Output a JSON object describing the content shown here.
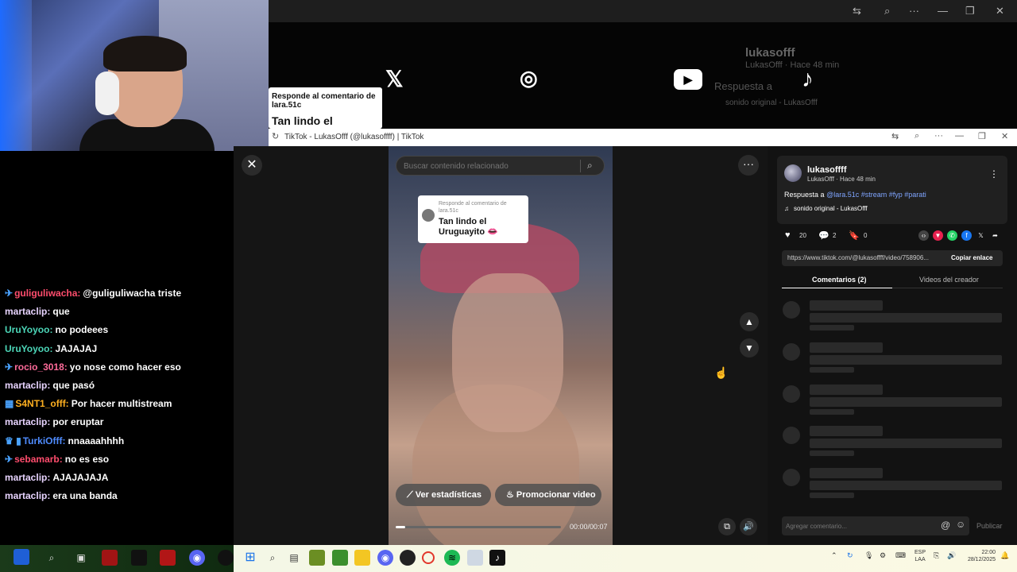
{
  "background_window": {
    "username": "lukasofff",
    "meta": "LukasOfff · Hace 48 min",
    "reply_prefix": "Respuesta a",
    "sound": "sonido original - LukasOfff",
    "reply_card_small": "Responde al comentario de lara.51c",
    "reply_card_large": "Tan lindo el"
  },
  "chat": [
    {
      "badge": "✈",
      "user": "guliguliwacha:",
      "user_color": "#ff4d6d",
      "msg": "@guliguliwacha triste"
    },
    {
      "badge": "",
      "user": "martaclip:",
      "user_color": "#e8d4ff",
      "msg": "que"
    },
    {
      "badge": "",
      "user": "UruYoyoo:",
      "user_color": "#4cd6b8",
      "msg": "no podeees"
    },
    {
      "badge": "",
      "user": "UruYoyoo:",
      "user_color": "#4cd6b8",
      "msg": "JAJAJAJ"
    },
    {
      "badge": "✈",
      "user": "rocio_3018:",
      "user_color": "#ff6b9a",
      "msg": "yo nose como hacer eso"
    },
    {
      "badge": "",
      "user": "martaclip:",
      "user_color": "#e8d4ff",
      "msg": "que pasó"
    },
    {
      "badge": "▦",
      "user": "S4NT1_offf:",
      "user_color": "#ffb020",
      "msg": "Por hacer multistream"
    },
    {
      "badge": "",
      "user": "martaclip:",
      "user_color": "#e8d4ff",
      "msg": "por eruptar"
    },
    {
      "badge": "♛ ▮",
      "user": "TurkiOfff:",
      "user_color": "#4f8cff",
      "msg": "nnaaaahhhh"
    },
    {
      "badge": "✈",
      "user": "sebamarb:",
      "user_color": "#ff4d6d",
      "msg": "no es eso"
    },
    {
      "badge": "",
      "user": "martaclip:",
      "user_color": "#e8d4ff",
      "msg": "AJAJAJAJA"
    },
    {
      "badge": "",
      "user": "martaclip:",
      "user_color": "#e8d4ff",
      "msg": "era una banda"
    }
  ],
  "window": {
    "title": "TikTok - LukasOfff (@lukasoffff) | TikTok"
  },
  "player": {
    "search_placeholder": "Buscar contenido relacionado",
    "reply_small": "Responde al comentario de lara.51c",
    "reply_text": "Tan lindo el Uruguayito 👄",
    "stats_label": "Ver estadísticas",
    "promote_label": "Promocionar video",
    "time": "00:00/00:07",
    "progress": 0.06
  },
  "post": {
    "username": "lukasoffff",
    "meta": "LukasOfff · Hace 48 min",
    "reply_prefix": "Respuesta a",
    "mention": "@lara.51c",
    "hashtags": "#stream #fyp #parati",
    "sound": "sonido original - LukasOfff",
    "likes": "20",
    "comments": "2",
    "saves": "0",
    "url": "https://www.tiktok.com/@lukasoffff/video/758906...",
    "copy_link": "Copiar enlace",
    "tab_comments": "Comentarios (2)",
    "tab_creator": "Videos del creador",
    "comment_placeholder": "Agregar comentario...",
    "publish": "Publicar"
  },
  "taskbar": {
    "lang_top": "ESP",
    "lang_bottom": "LAA",
    "time": "22:00",
    "date": "28/12/2025"
  }
}
